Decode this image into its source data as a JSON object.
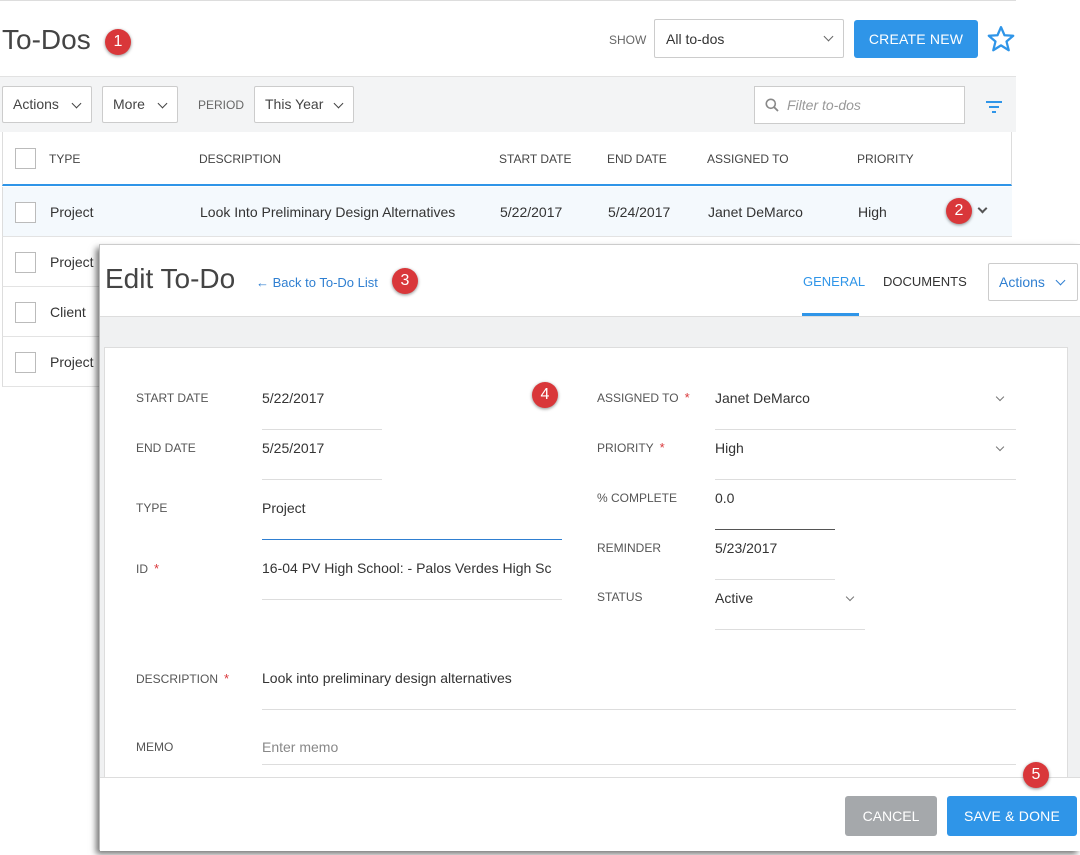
{
  "header": {
    "title": "To-Dos",
    "show_label": "SHOW",
    "show_value": "All to-dos",
    "create_label": "CREATE NEW"
  },
  "toolbar": {
    "actions_label": "Actions",
    "more_label": "More",
    "period_label": "PERIOD",
    "period_value": "This Year",
    "filter_placeholder": "Filter to-dos"
  },
  "table": {
    "columns": [
      "TYPE",
      "DESCRIPTION",
      "START DATE",
      "END DATE",
      "ASSIGNED TO",
      "PRIORITY"
    ],
    "rows": [
      {
        "type": "Project",
        "description": "Look Into Preliminary Design Alternatives",
        "start": "5/22/2017",
        "end": "5/24/2017",
        "assigned": "Janet DeMarco",
        "priority": "High"
      },
      {
        "type": "Project"
      },
      {
        "type": "Client"
      },
      {
        "type": "Project"
      }
    ]
  },
  "modal": {
    "title": "Edit To-Do",
    "back_link": "← Back to To-Do List",
    "tabs": [
      "GENERAL",
      "DOCUMENTS"
    ],
    "actions_label": "Actions",
    "fields": {
      "start_date": {
        "label": "START DATE",
        "value": "5/22/2017"
      },
      "end_date": {
        "label": "END DATE",
        "value": "5/25/2017"
      },
      "type": {
        "label": "TYPE",
        "value": "Project"
      },
      "id": {
        "label": "ID",
        "value": "16-04 PV High School: - Palos Verdes High Sc"
      },
      "assigned_to": {
        "label": "ASSIGNED TO",
        "value": "Janet DeMarco"
      },
      "priority": {
        "label": "PRIORITY",
        "value": "High"
      },
      "complete": {
        "label": "% COMPLETE",
        "value": "0.0"
      },
      "reminder": {
        "label": "REMINDER",
        "value": "5/23/2017"
      },
      "status": {
        "label": "STATUS",
        "value": "Active"
      },
      "description": {
        "label": "DESCRIPTION",
        "value": "Look into preliminary design alternatives"
      },
      "memo": {
        "label": "MEMO",
        "placeholder": "Enter memo"
      }
    },
    "required_mark": "*",
    "cancel_label": "CANCEL",
    "save_label": "SAVE & DONE"
  },
  "badges": [
    "1",
    "2",
    "3",
    "4",
    "5"
  ],
  "colors": {
    "accent": "#2f95e8",
    "badge": "#d9373a",
    "cancel": "#a5a8ab"
  }
}
